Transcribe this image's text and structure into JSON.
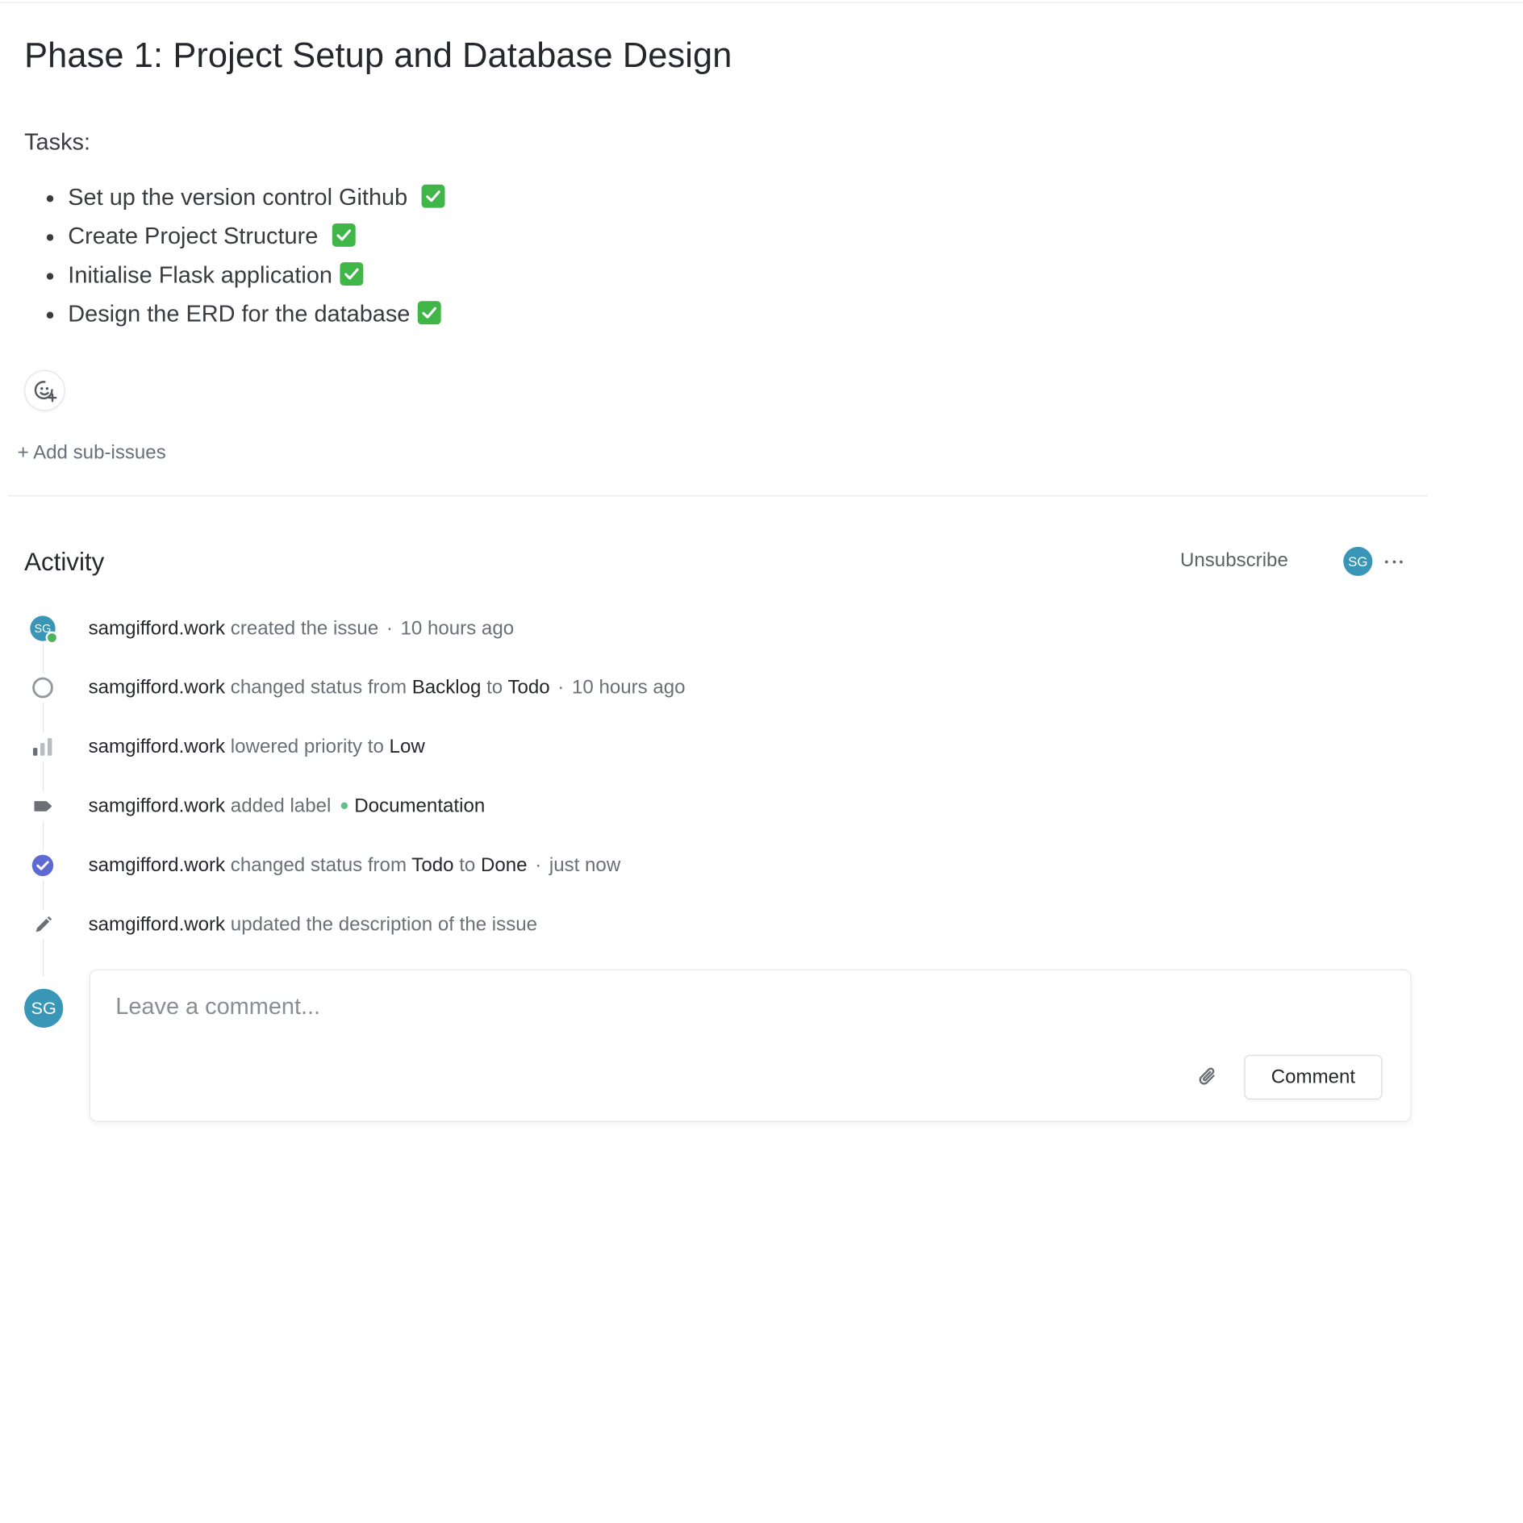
{
  "issue": {
    "title": "Phase 1: Project Setup and Database Design",
    "tasks_label": "Tasks:",
    "tasks": [
      {
        "text": "Set up the version control Github ",
        "done": true
      },
      {
        "text": "Create Project Structure ",
        "done": true
      },
      {
        "text": "Initialise Flask application",
        "done": true
      },
      {
        "text": "Design the ERD for the database",
        "done": true
      }
    ],
    "add_sub_issues_label": "+ Add sub-issues"
  },
  "activity": {
    "title": "Activity",
    "unsubscribe_label": "Unsubscribe",
    "subscriber_initials": "SG",
    "events": [
      {
        "icon": "avatar",
        "initials": "SG",
        "actor": "samgifford.work",
        "action": "created the issue",
        "time": "10 hours ago"
      },
      {
        "icon": "status-circle-icon",
        "actor": "samgifford.work",
        "action": "changed status from",
        "from": "Backlog",
        "to_word": "to",
        "to": "Todo",
        "time": "10 hours ago"
      },
      {
        "icon": "priority-bars-icon",
        "actor": "samgifford.work",
        "action": "lowered priority to",
        "value": "Low"
      },
      {
        "icon": "label-tag-icon",
        "actor": "samgifford.work",
        "action": "added label",
        "value": "Documentation",
        "label_color": "#5fc08e"
      },
      {
        "icon": "done-check-icon",
        "actor": "samgifford.work",
        "action": "changed status from",
        "from": "Todo",
        "to_word": "to",
        "to": "Done",
        "time": "just now"
      },
      {
        "icon": "pencil-icon",
        "actor": "samgifford.work",
        "action": "updated the description of the issue"
      }
    ]
  },
  "comment": {
    "avatar_initials": "SG",
    "placeholder": "Leave a comment...",
    "button_label": "Comment"
  },
  "colors": {
    "avatar": "#3a96b7",
    "done": "#5e6ad2",
    "check_emoji": "#41b648",
    "online": "#4cb35c"
  }
}
